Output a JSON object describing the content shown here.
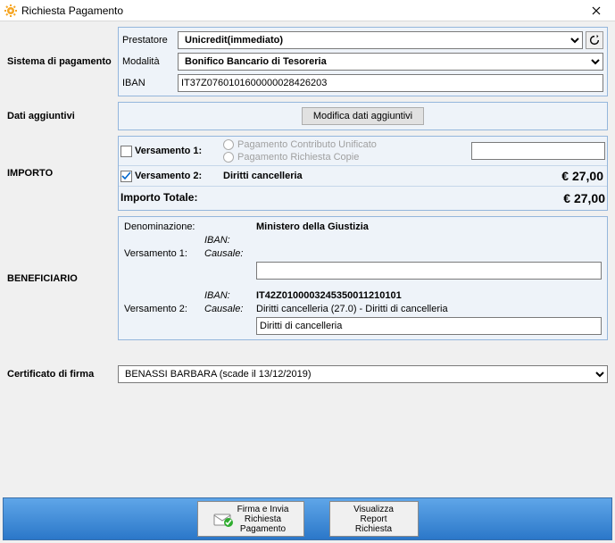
{
  "window": {
    "title": "Richiesta Pagamento"
  },
  "sys": {
    "section_label": "Sistema di pagamento",
    "prestatore_label": "Prestatore",
    "prestatore_value": "Unicredit(immediato)",
    "modalita_label": "Modalità",
    "modalita_value": "Bonifico Bancario di Tesoreria",
    "iban_label": "IBAN",
    "iban_value": "IT37Z0760101600000028426203"
  },
  "additional": {
    "section_label": "Dati aggiuntivi",
    "button_label": "Modifica dati aggiuntivi"
  },
  "importo": {
    "section_label": "IMPORTO",
    "v1_label": "Versamento 1:",
    "v1_checked": false,
    "v1_opt1": "Pagamento Contributo Unificato",
    "v1_opt2": "Pagamento Richiesta Copie",
    "v1_amount": "",
    "v2_label": "Versamento 2:",
    "v2_checked": true,
    "v2_desc": "Diritti cancelleria",
    "v2_amount": "€ 27,00",
    "total_label": "Importo Totale:",
    "total_value": "€ 27,00"
  },
  "benef": {
    "section_label": "BENEFICIARIO",
    "denom_label": "Denominazione:",
    "denom_value": "Ministero della Giustizia",
    "v1_label": "Versamento 1:",
    "v1_iban_label": "IBAN:",
    "v1_iban_value": "",
    "v1_causale_label": "Causale:",
    "v1_causale_value": "",
    "v1_input": "",
    "v2_label": "Versamento 2:",
    "v2_iban_label": "IBAN:",
    "v2_iban_value": "IT42Z0100003245350011210101",
    "v2_causale_label": "Causale:",
    "v2_causale_value": "Diritti cancelleria (27.0) - Diritti di cancelleria",
    "v2_input": "Diritti di cancelleria"
  },
  "cert": {
    "section_label": "Certificato di firma",
    "value": "BENASSI BARBARA (scade il 13/12/2019)"
  },
  "actions": {
    "sign_send": "Firma e Invia\nRichiesta\nPagamento",
    "view_report": "Visualizza\nReport\nRichiesta"
  }
}
